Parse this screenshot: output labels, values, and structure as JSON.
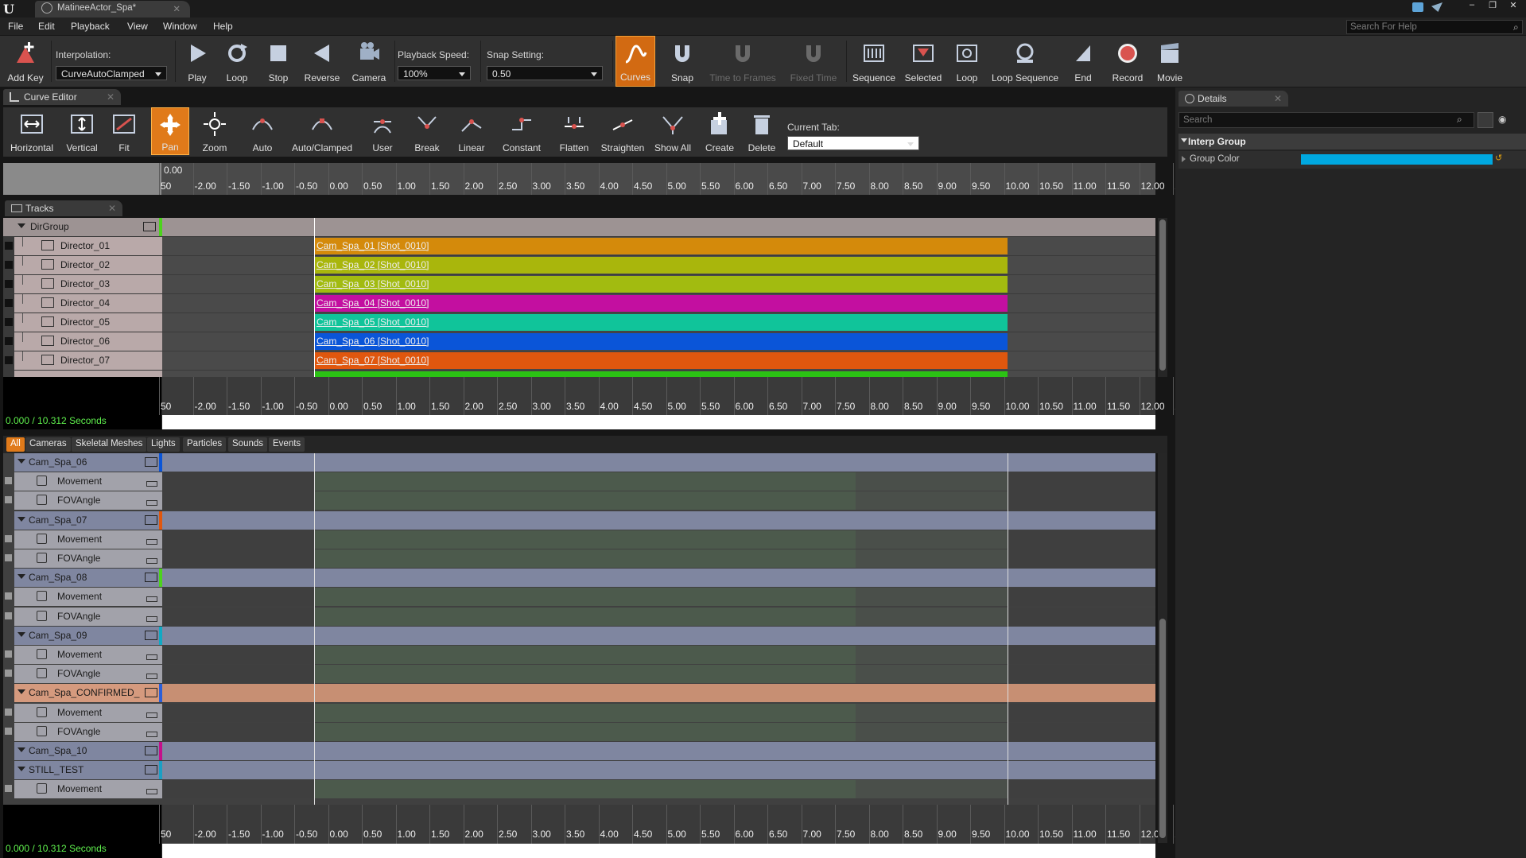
{
  "window": {
    "tab_title": "MatineeActor_Spa*",
    "logo": "U",
    "min": "–",
    "restore": "❐",
    "close": "✕"
  },
  "menu": [
    "File",
    "Edit",
    "Playback",
    "View",
    "Window",
    "Help"
  ],
  "help_search": {
    "placeholder": "Search For Help"
  },
  "toolbar": {
    "add_key": "Add Key",
    "interpolation_label": "Interpolation:",
    "interpolation_value": "CurveAutoClamped",
    "play": "Play",
    "loop": "Loop",
    "stop": "Stop",
    "reverse": "Reverse",
    "camera": "Camera",
    "playback_speed_label": "Playback Speed:",
    "playback_speed_value": "100%",
    "snap_setting_label": "Snap Setting:",
    "snap_setting_value": "0.50",
    "curves": "Curves",
    "snap": "Snap",
    "time_to_frames": "Time to Frames",
    "fixed_time": "Fixed Time",
    "sequence": "Sequence",
    "selected": "Selected",
    "loop2": "Loop",
    "loop_sequence": "Loop Sequence",
    "end": "End",
    "record": "Record",
    "movie": "Movie"
  },
  "curve_editor": {
    "tab": "Curve Editor",
    "tools": [
      "Horizontal",
      "Vertical",
      "Fit",
      "Pan",
      "Zoom",
      "Auto",
      "Auto/Clamped",
      "User",
      "Break",
      "Linear",
      "Constant",
      "Flatten",
      "Straighten",
      "Show All",
      "Create",
      "Delete"
    ],
    "current_tab_label": "Current Tab:",
    "current_tab_value": "Default",
    "ruler_origin": "0.00"
  },
  "ruler_ticks": [
    "50",
    "-2.00",
    "-1.50",
    "-1.00",
    "-0.50",
    "0.00",
    "0.50",
    "1.00",
    "1.50",
    "2.00",
    "2.50",
    "3.00",
    "3.50",
    "4.00",
    "4.50",
    "5.00",
    "5.50",
    "6.00",
    "6.50",
    "7.00",
    "7.50",
    "8.00",
    "8.50",
    "9.00",
    "9.50",
    "10.00",
    "10.50",
    "11.00",
    "11.50",
    "12.00",
    "1"
  ],
  "tracks": {
    "tab": "Tracks",
    "group": "DirGroup",
    "directors": [
      {
        "name": "Director_01",
        "shot": "Cam_Spa_01 [Shot_0010]",
        "color": "#d48a0b"
      },
      {
        "name": "Director_02",
        "shot": "Cam_Spa_02 [Shot_0010]",
        "color": "#a9b60c"
      },
      {
        "name": "Director_03",
        "shot": "Cam_Spa_03 [Shot_0010]",
        "color": "#a2bb10"
      },
      {
        "name": "Director_04",
        "shot": "Cam_Spa_04 [Shot_0010]",
        "color": "#c30fa0"
      },
      {
        "name": "Director_05",
        "shot": "Cam_Spa_05 [Shot_0010]",
        "color": "#10c49a"
      },
      {
        "name": "Director_06",
        "shot": "Cam_Spa_06 [Shot_0010]",
        "color": "#0a55d8"
      },
      {
        "name": "Director_07",
        "shot": "Cam_Spa_07 [Shot_0010]",
        "color": "#e0570e"
      }
    ],
    "status": "0.000 / 10.312 Seconds"
  },
  "filter_tabs": [
    "All",
    "Cameras",
    "Skeletal Meshes",
    "Lights",
    "Particles",
    "Sounds",
    "Events"
  ],
  "bottom_tracks": [
    {
      "label": "Cam_Spa_06",
      "type": "group",
      "color": "#0a55d8"
    },
    {
      "label": "Movement",
      "type": "sub"
    },
    {
      "label": "FOVAngle",
      "type": "sub"
    },
    {
      "label": "Cam_Spa_07",
      "type": "group",
      "color": "#e0570e"
    },
    {
      "label": "Movement",
      "type": "sub"
    },
    {
      "label": "FOVAngle",
      "type": "sub"
    },
    {
      "label": "Cam_Spa_08",
      "type": "group",
      "color": "#4cd31c"
    },
    {
      "label": "Movement",
      "type": "sub"
    },
    {
      "label": "FOVAngle",
      "type": "sub"
    },
    {
      "label": "Cam_Spa_09",
      "type": "group",
      "color": "#10a9c4"
    },
    {
      "label": "Movement",
      "type": "sub"
    },
    {
      "label": "FOVAngle",
      "type": "sub"
    },
    {
      "label": "Cam_Spa_CONFIRMED_",
      "type": "sel",
      "color": "#2a5fd8"
    },
    {
      "label": "Movement",
      "type": "sub"
    },
    {
      "label": "FOVAngle",
      "type": "sub"
    },
    {
      "label": "Cam_Spa_10",
      "type": "group",
      "color": "#c40f8a"
    },
    {
      "label": "STILL_TEST",
      "type": "group",
      "color": "#1a9fc4"
    },
    {
      "label": "Movement",
      "type": "sub"
    }
  ],
  "bottom_status": "0.000 / 10.312 Seconds",
  "details": {
    "tab": "Details",
    "search_placeholder": "Search",
    "category": "Interp Group",
    "group_color_label": "Group Color",
    "group_color": "#00a8e0"
  }
}
